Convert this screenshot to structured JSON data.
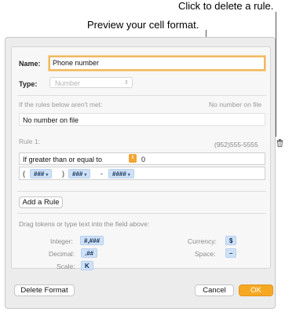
{
  "callouts": {
    "delete_rule": "Click to delete a rule.",
    "preview": "Preview your cell format."
  },
  "name": {
    "label": "Name:",
    "value": "Phone number"
  },
  "type": {
    "label": "Type:",
    "value": "Number"
  },
  "rules_not_met": {
    "label": "If the rules below aren't met:",
    "preview": "No number on file",
    "value": "No number on file"
  },
  "rule1": {
    "label": "Rule 1:",
    "preview": "(952)555-5555",
    "condition": "If greater than or equal to",
    "threshold": "0",
    "format_tokens": {
      "open_paren": "(",
      "area": "###",
      "close_paren": ")",
      "prefix": "###",
      "dash": "-",
      "line": "####"
    }
  },
  "add_rule_label": "Add a Rule",
  "tokens_help": "Drag tokens or type text into the field above:",
  "tokens": {
    "integer_label": "Integer:",
    "integer_token": "#,###",
    "decimal_label": "Decimal:",
    "decimal_token": ".##",
    "scale_label": "Scale:",
    "scale_token": "K",
    "currency_label": "Currency:",
    "currency_token": "$",
    "space_label": "Space:",
    "space_token": "–"
  },
  "footer": {
    "delete_format": "Delete Format",
    "cancel": "Cancel",
    "ok": "OK"
  },
  "icons": {
    "trash": "trash-icon",
    "popup_chevron": "chevron-updown-icon",
    "token_chevron": "chevron-down-icon"
  },
  "colors": {
    "accent": "#f7a823",
    "token_bg": "#cfe1f6",
    "focus_ring": "#f0b860"
  }
}
